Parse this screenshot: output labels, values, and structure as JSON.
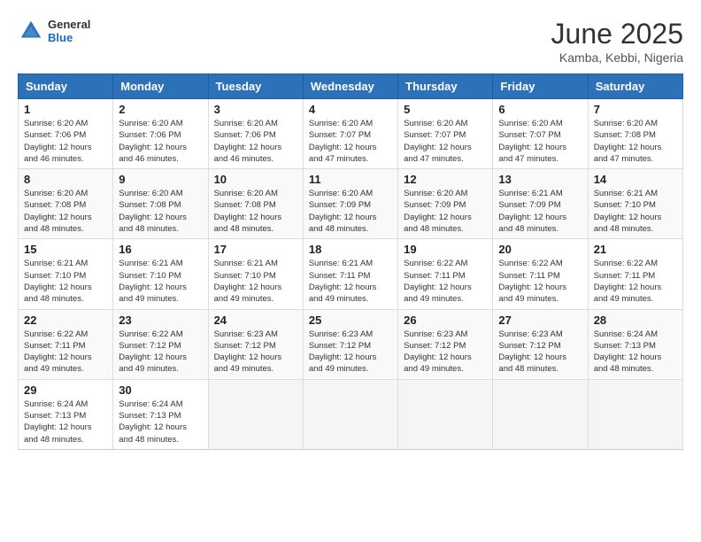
{
  "header": {
    "logo_general": "General",
    "logo_blue": "Blue",
    "month_title": "June 2025",
    "subtitle": "Kamba, Kebbi, Nigeria"
  },
  "days_of_week": [
    "Sunday",
    "Monday",
    "Tuesday",
    "Wednesday",
    "Thursday",
    "Friday",
    "Saturday"
  ],
  "weeks": [
    [
      {
        "day": 1,
        "sunrise": "6:20 AM",
        "sunset": "7:06 PM",
        "daylight": "12 hours and 46 minutes."
      },
      {
        "day": 2,
        "sunrise": "6:20 AM",
        "sunset": "7:06 PM",
        "daylight": "12 hours and 46 minutes."
      },
      {
        "day": 3,
        "sunrise": "6:20 AM",
        "sunset": "7:06 PM",
        "daylight": "12 hours and 46 minutes."
      },
      {
        "day": 4,
        "sunrise": "6:20 AM",
        "sunset": "7:07 PM",
        "daylight": "12 hours and 47 minutes."
      },
      {
        "day": 5,
        "sunrise": "6:20 AM",
        "sunset": "7:07 PM",
        "daylight": "12 hours and 47 minutes."
      },
      {
        "day": 6,
        "sunrise": "6:20 AM",
        "sunset": "7:07 PM",
        "daylight": "12 hours and 47 minutes."
      },
      {
        "day": 7,
        "sunrise": "6:20 AM",
        "sunset": "7:08 PM",
        "daylight": "12 hours and 47 minutes."
      }
    ],
    [
      {
        "day": 8,
        "sunrise": "6:20 AM",
        "sunset": "7:08 PM",
        "daylight": "12 hours and 48 minutes."
      },
      {
        "day": 9,
        "sunrise": "6:20 AM",
        "sunset": "7:08 PM",
        "daylight": "12 hours and 48 minutes."
      },
      {
        "day": 10,
        "sunrise": "6:20 AM",
        "sunset": "7:08 PM",
        "daylight": "12 hours and 48 minutes."
      },
      {
        "day": 11,
        "sunrise": "6:20 AM",
        "sunset": "7:09 PM",
        "daylight": "12 hours and 48 minutes."
      },
      {
        "day": 12,
        "sunrise": "6:20 AM",
        "sunset": "7:09 PM",
        "daylight": "12 hours and 48 minutes."
      },
      {
        "day": 13,
        "sunrise": "6:21 AM",
        "sunset": "7:09 PM",
        "daylight": "12 hours and 48 minutes."
      },
      {
        "day": 14,
        "sunrise": "6:21 AM",
        "sunset": "7:10 PM",
        "daylight": "12 hours and 48 minutes."
      }
    ],
    [
      {
        "day": 15,
        "sunrise": "6:21 AM",
        "sunset": "7:10 PM",
        "daylight": "12 hours and 48 minutes."
      },
      {
        "day": 16,
        "sunrise": "6:21 AM",
        "sunset": "7:10 PM",
        "daylight": "12 hours and 49 minutes."
      },
      {
        "day": 17,
        "sunrise": "6:21 AM",
        "sunset": "7:10 PM",
        "daylight": "12 hours and 49 minutes."
      },
      {
        "day": 18,
        "sunrise": "6:21 AM",
        "sunset": "7:11 PM",
        "daylight": "12 hours and 49 minutes."
      },
      {
        "day": 19,
        "sunrise": "6:22 AM",
        "sunset": "7:11 PM",
        "daylight": "12 hours and 49 minutes."
      },
      {
        "day": 20,
        "sunrise": "6:22 AM",
        "sunset": "7:11 PM",
        "daylight": "12 hours and 49 minutes."
      },
      {
        "day": 21,
        "sunrise": "6:22 AM",
        "sunset": "7:11 PM",
        "daylight": "12 hours and 49 minutes."
      }
    ],
    [
      {
        "day": 22,
        "sunrise": "6:22 AM",
        "sunset": "7:11 PM",
        "daylight": "12 hours and 49 minutes."
      },
      {
        "day": 23,
        "sunrise": "6:22 AM",
        "sunset": "7:12 PM",
        "daylight": "12 hours and 49 minutes."
      },
      {
        "day": 24,
        "sunrise": "6:23 AM",
        "sunset": "7:12 PM",
        "daylight": "12 hours and 49 minutes."
      },
      {
        "day": 25,
        "sunrise": "6:23 AM",
        "sunset": "7:12 PM",
        "daylight": "12 hours and 49 minutes."
      },
      {
        "day": 26,
        "sunrise": "6:23 AM",
        "sunset": "7:12 PM",
        "daylight": "12 hours and 49 minutes."
      },
      {
        "day": 27,
        "sunrise": "6:23 AM",
        "sunset": "7:12 PM",
        "daylight": "12 hours and 48 minutes."
      },
      {
        "day": 28,
        "sunrise": "6:24 AM",
        "sunset": "7:13 PM",
        "daylight": "12 hours and 48 minutes."
      }
    ],
    [
      {
        "day": 29,
        "sunrise": "6:24 AM",
        "sunset": "7:13 PM",
        "daylight": "12 hours and 48 minutes."
      },
      {
        "day": 30,
        "sunrise": "6:24 AM",
        "sunset": "7:13 PM",
        "daylight": "12 hours and 48 minutes."
      },
      null,
      null,
      null,
      null,
      null
    ]
  ]
}
